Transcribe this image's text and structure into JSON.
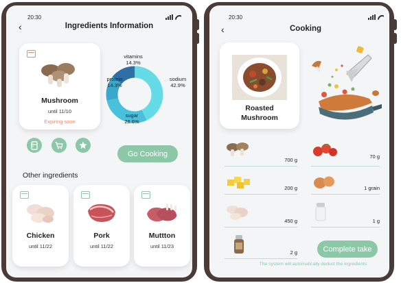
{
  "colors": {
    "device_frame": "#4a3b39",
    "accent_green": "#8cc7a8",
    "warning": "#e58b6d",
    "donut": [
      "#66dbe8",
      "#2e6fa5",
      "#3aa8cc",
      "#4ac1dc"
    ]
  },
  "left_screen": {
    "status_time": "20:30",
    "title": "Ingredients Information",
    "ingredient": {
      "name": "Mushroom",
      "until": "until 11/10",
      "status": "Expiring soon"
    },
    "nutrition": [
      {
        "label": "vitamins",
        "value": "14.3%"
      },
      {
        "label": "protein",
        "value": "14.3%"
      },
      {
        "label": "sodium",
        "value": "42.9%"
      },
      {
        "label": "sugar",
        "value": "28.6%"
      }
    ],
    "go_cooking": "Go Cooking",
    "other_title": "Other ingredients",
    "others": [
      {
        "name": "Chicken",
        "until": "until 11/22"
      },
      {
        "name": "Pork",
        "until": "until 11/22"
      },
      {
        "name": "Muttton",
        "until": "until 11/23"
      }
    ]
  },
  "right_screen": {
    "status_time": "20:30",
    "title": "Cooking",
    "dish": {
      "line1": "Roasted",
      "line2": "Mushroom"
    },
    "ingredients": [
      {
        "item": "mushroom",
        "amount": "700 g"
      },
      {
        "item": "tomato",
        "amount": "70 g"
      },
      {
        "item": "potato-cubes",
        "amount": "200 g"
      },
      {
        "item": "egg",
        "amount": "1 grain"
      },
      {
        "item": "chicken",
        "amount": "450 g"
      },
      {
        "item": "salt",
        "amount": "1 g"
      },
      {
        "item": "pepper",
        "amount": "2 g"
      }
    ],
    "complete_button": "Complete take",
    "footer_note": "The system will automatically deduct the ingredients"
  }
}
